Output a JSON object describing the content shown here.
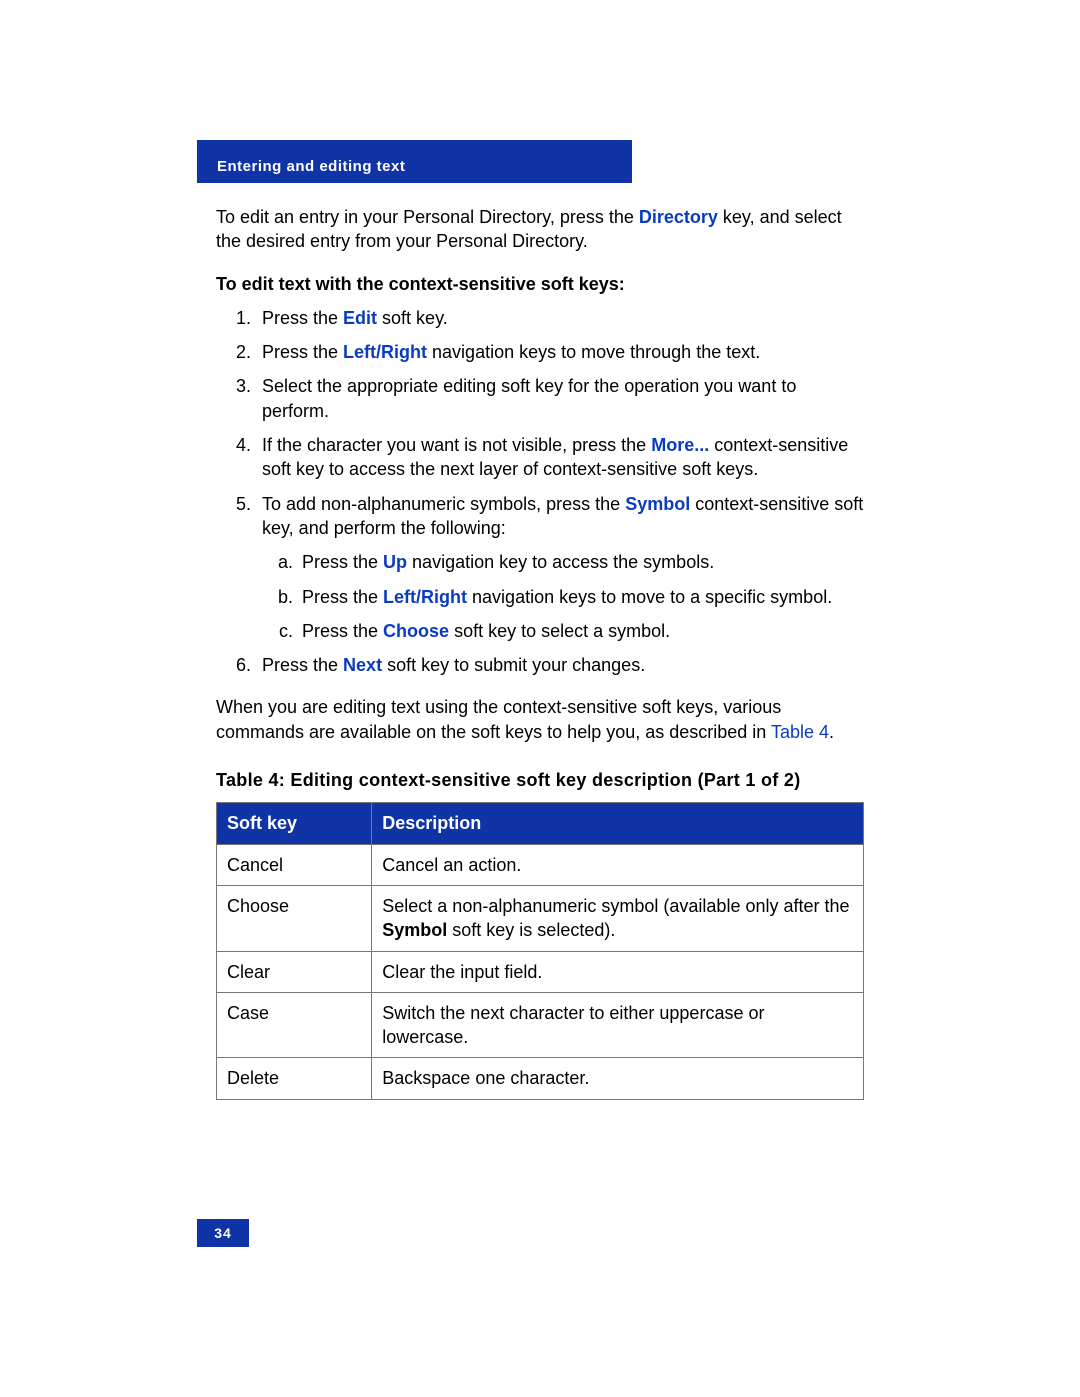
{
  "header": "Entering and editing text",
  "intro": {
    "pre": "To edit an entry in your Personal Directory, press the ",
    "kw": "Directory",
    "post": " key, and select the desired entry from your Personal Directory."
  },
  "subhead": "To edit text with the context-sensitive soft keys:",
  "steps": {
    "s1": {
      "pre": "Press the ",
      "kw": "Edit",
      "post": " soft key."
    },
    "s2": {
      "pre": "Press the ",
      "kw": "Left/Right",
      "post": " navigation keys to move through the text."
    },
    "s3": "Select the appropriate editing soft key for the operation you want to perform.",
    "s4": {
      "pre": "If the character you want is not visible, press the ",
      "kw": "More...",
      "post": " context-sensitive soft key to access the next layer of context-sensitive soft keys."
    },
    "s5": {
      "pre": "To add non-alphanumeric symbols, press the ",
      "kw": "Symbol",
      "post": " context-sensitive soft key, and perform the following:",
      "a": {
        "pre": "Press the ",
        "kw": "Up",
        "post": " navigation key to access the symbols."
      },
      "b": {
        "pre": "Press the ",
        "kw": "Left/Right",
        "post": " navigation keys to move to a specific symbol."
      },
      "c": {
        "pre": "Press the ",
        "kw": "Choose",
        "post": " soft key to select a symbol."
      }
    },
    "s6": {
      "pre": "Press the ",
      "kw": "Next",
      "post": " soft key to submit your changes."
    }
  },
  "closing": {
    "text": "When you are editing text using the context-sensitive soft keys, various commands are available on the soft keys to help you, as described in ",
    "ref": "Table 4",
    "post": "."
  },
  "table": {
    "caption": "Table 4: Editing context-sensitive soft key description (Part 1 of 2)",
    "headers": {
      "c1": "Soft key",
      "c2": "Description"
    },
    "rows": [
      {
        "key": "Cancel",
        "desc_pre": "Cancel an action.",
        "bold": "",
        "desc_post": ""
      },
      {
        "key": "Choose",
        "desc_pre": "Select a non-alphanumeric symbol (available only after the ",
        "bold": "Symbol",
        "desc_post": " soft key is selected)."
      },
      {
        "key": "Clear",
        "desc_pre": "Clear the input field.",
        "bold": "",
        "desc_post": ""
      },
      {
        "key": "Case",
        "desc_pre": "Switch the next character to either uppercase or lowercase.",
        "bold": "",
        "desc_post": ""
      },
      {
        "key": "Delete",
        "desc_pre": "Backspace one character.",
        "bold": "",
        "desc_post": ""
      }
    ]
  },
  "page_number": "34"
}
